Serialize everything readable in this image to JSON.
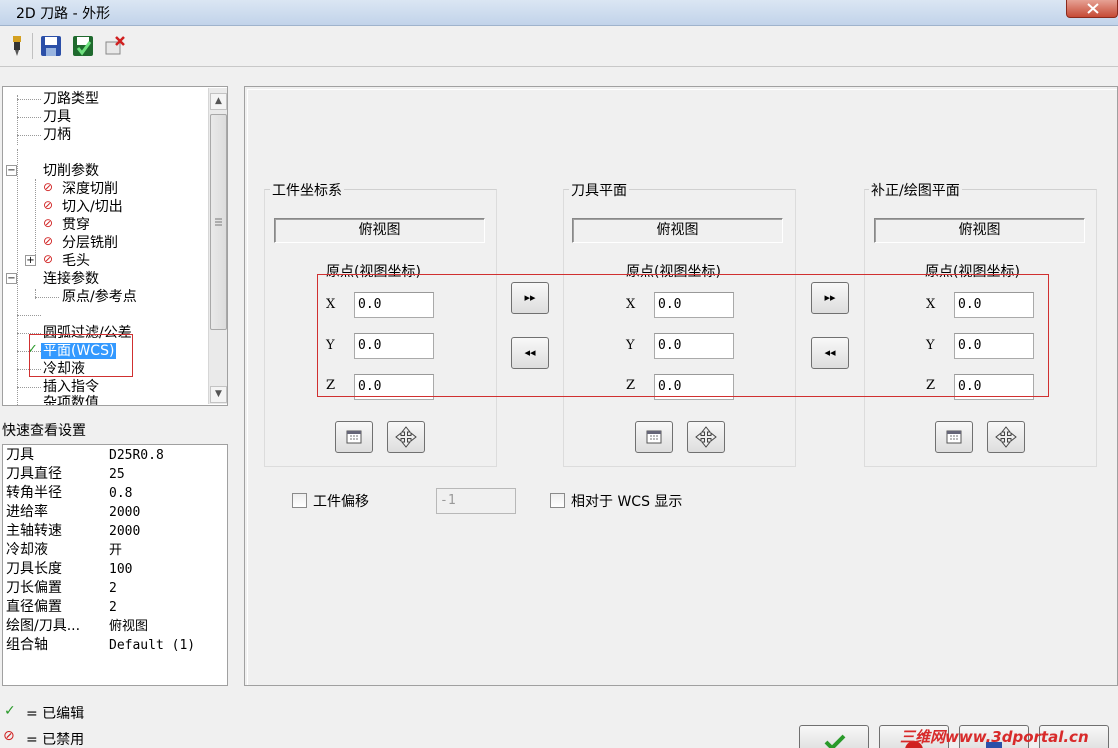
{
  "window": {
    "title": "2D 刀路 - 外形"
  },
  "tree": {
    "items": [
      {
        "label": "刀路类型"
      },
      {
        "label": "刀具"
      },
      {
        "label": "刀柄"
      },
      {
        "label": "切削参数"
      },
      {
        "label": "深度切削"
      },
      {
        "label": "切入/切出"
      },
      {
        "label": "贯穿"
      },
      {
        "label": "分层铣削"
      },
      {
        "label": "毛头"
      },
      {
        "label": "连接参数"
      },
      {
        "label": "原点/参考点"
      },
      {
        "label": "圆弧过滤/公差"
      },
      {
        "label": "平面(WCS)"
      },
      {
        "label": "冷却液"
      },
      {
        "label": "插入指令"
      },
      {
        "label": "杂项数值"
      }
    ]
  },
  "quick_view": {
    "title": "快速查看设置",
    "rows": [
      {
        "key": "刀具",
        "value": "D25R0.8"
      },
      {
        "key": "刀具直径",
        "value": "25"
      },
      {
        "key": "转角半径",
        "value": "0.8"
      },
      {
        "key": "进给率",
        "value": "2000"
      },
      {
        "key": "主轴转速",
        "value": "2000"
      },
      {
        "key": "冷却液",
        "value": "开"
      },
      {
        "key": "刀具长度",
        "value": "100"
      },
      {
        "key": "刀长偏置",
        "value": "2"
      },
      {
        "key": "直径偏置",
        "value": "2"
      },
      {
        "key": "绘图/刀具...",
        "value": "俯视图"
      },
      {
        "key": "组合轴",
        "value": "Default (1)"
      }
    ]
  },
  "legend": {
    "edited_symbol": "✓",
    "edited_label": "= 已编辑",
    "disabled_symbol": "⊘",
    "disabled_label": "= 已禁用"
  },
  "groups": [
    {
      "title": "工件坐标系",
      "view": "俯视图",
      "origin_label": "原点(视图坐标)",
      "x": "0.0",
      "y": "0.0",
      "z": "0.0"
    },
    {
      "title": "刀具平面",
      "view": "俯视图",
      "origin_label": "原点(视图坐标)",
      "x": "0.0",
      "y": "0.0",
      "z": "0.0"
    },
    {
      "title": "补正/绘图平面",
      "view": "俯视图",
      "origin_label": "原点(视图坐标)",
      "x": "0.0",
      "y": "0.0",
      "z": "0.0"
    }
  ],
  "axes": {
    "x": "X",
    "y": "Y",
    "z": "Z"
  },
  "copy_buttons": {
    "forward": "▸▸",
    "back": "◂◂"
  },
  "work_offset": {
    "label": "工件偏移",
    "checked": false,
    "value": "-1"
  },
  "relative_wcs": {
    "label": "相对于 WCS 显示",
    "checked": false
  },
  "watermark": "三维网www.3dportal.cn",
  "colors": {
    "selection": "#3399ff",
    "edited": "#2a9a2a",
    "disabled": "#d02020",
    "annotation": "#d03030"
  }
}
